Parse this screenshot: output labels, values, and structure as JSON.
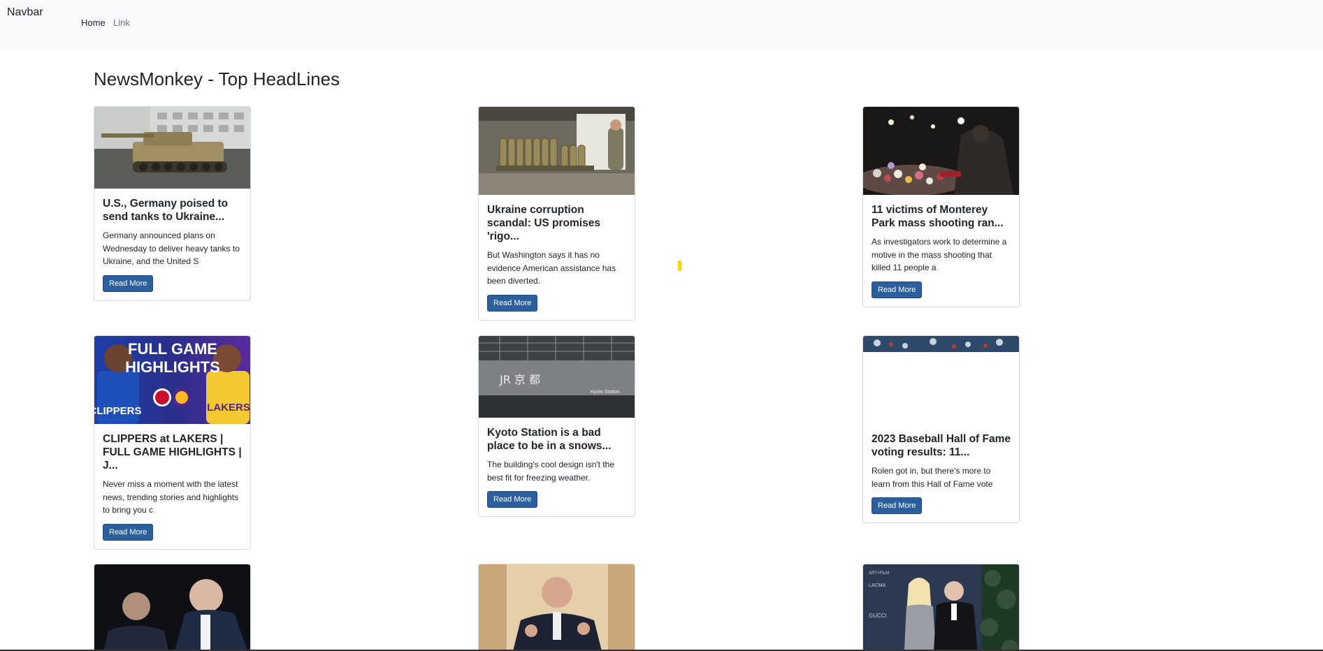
{
  "navbar": {
    "brand": "Navbar",
    "links": [
      "Home",
      "Link"
    ]
  },
  "page": {
    "title": "NewsMonkey - Top HeadLines"
  },
  "cards": [
    {
      "title": "U.S., Germany poised to send tanks to Ukraine...",
      "text": "Germany announced plans on Wednesday to deliver heavy tanks to Ukraine, and the United S",
      "button": "Read More",
      "image": "tank-photo"
    },
    {
      "title": "Ukraine corruption scandal: US promises 'rigo...",
      "text": "But Washington says it has no evidence American assistance has been diverted.",
      "button": "Read More",
      "image": "artillery-shells-photo"
    },
    {
      "title": "11 victims of Monterey Park mass shooting ran...",
      "text": "As investigators work to determine a motive in the mass shooting that killed 11 people a",
      "button": "Read More",
      "image": "memorial-photo"
    },
    {
      "title": "CLIPPERS at LAKERS | FULL GAME HIGHLIGHTS | J...",
      "text": "Never miss a moment with the latest news, trending stories and highlights to bring you c",
      "button": "Read More",
      "image": "basketball-highlights-thumbnail",
      "image_text": {
        "line1": "FULL GAME",
        "line2": "HIGHLIGHTS",
        "left_team": "CLIPPERS",
        "right_team": "LAKERS"
      }
    },
    {
      "title": "Kyoto Station is a bad place to be in a snows...",
      "text": "The building's cool design isn't the best fit for freezing weather.",
      "button": "Read More",
      "image": "kyoto-station-photo",
      "image_text": {
        "sign": "JR 京 都",
        "small": "Kyoto Station"
      }
    },
    {
      "title": "2023 Baseball Hall of Fame voting results: 11...",
      "text": "Rolen got in, but there's more to learn from this Hall of Fame vote",
      "button": "Read More",
      "image": "baseball-photo-partial"
    },
    {
      "title": "",
      "text": "",
      "button": "",
      "image": "politicians-photo"
    },
    {
      "title": "",
      "text": "",
      "button": "",
      "image": "speaker-photo"
    },
    {
      "title": "",
      "text": "",
      "button": "",
      "image": "red-carpet-photo",
      "image_text": {
        "a": "ART+FILM",
        "b": "LACMA",
        "c": "GUCCI"
      }
    }
  ],
  "colors": {
    "navbar_bg": "#f8f9fa",
    "button": "#2c5f9e",
    "accent_mark": "#f5d90a"
  }
}
